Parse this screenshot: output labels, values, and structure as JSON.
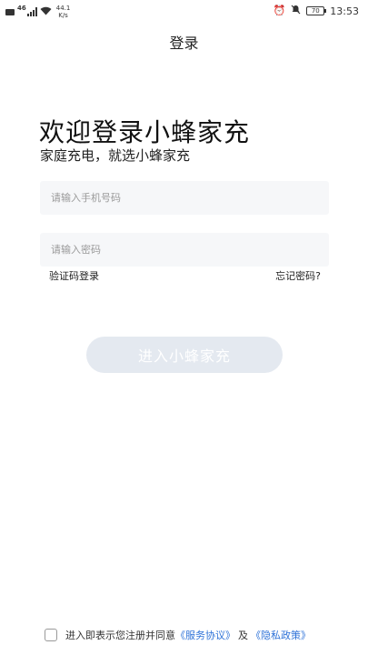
{
  "status_bar": {
    "signal_label": "46",
    "speed_value": "44.1",
    "speed_unit": "K/s",
    "battery_level": "70",
    "time": "13:53"
  },
  "header": {
    "title": "登录"
  },
  "welcome": {
    "title": "欢迎登录小蜂家充",
    "subtitle": "家庭充电，就选小蜂家充"
  },
  "form": {
    "phone_placeholder": "请输入手机号码",
    "password_placeholder": "请输入密码",
    "sms_login_label": "验证码登录",
    "forgot_password_label": "忘记密码?",
    "submit_label": "进入小蜂家充"
  },
  "agreement": {
    "prefix": "进入即表示您注册并同意",
    "service_link": "《服务协议》",
    "and": "及",
    "privacy_link": "《隐私政策》"
  },
  "colors": {
    "link": "#2f73d8",
    "button_disabled": "#e4e9f0",
    "input_bg": "#f6f7f9"
  }
}
